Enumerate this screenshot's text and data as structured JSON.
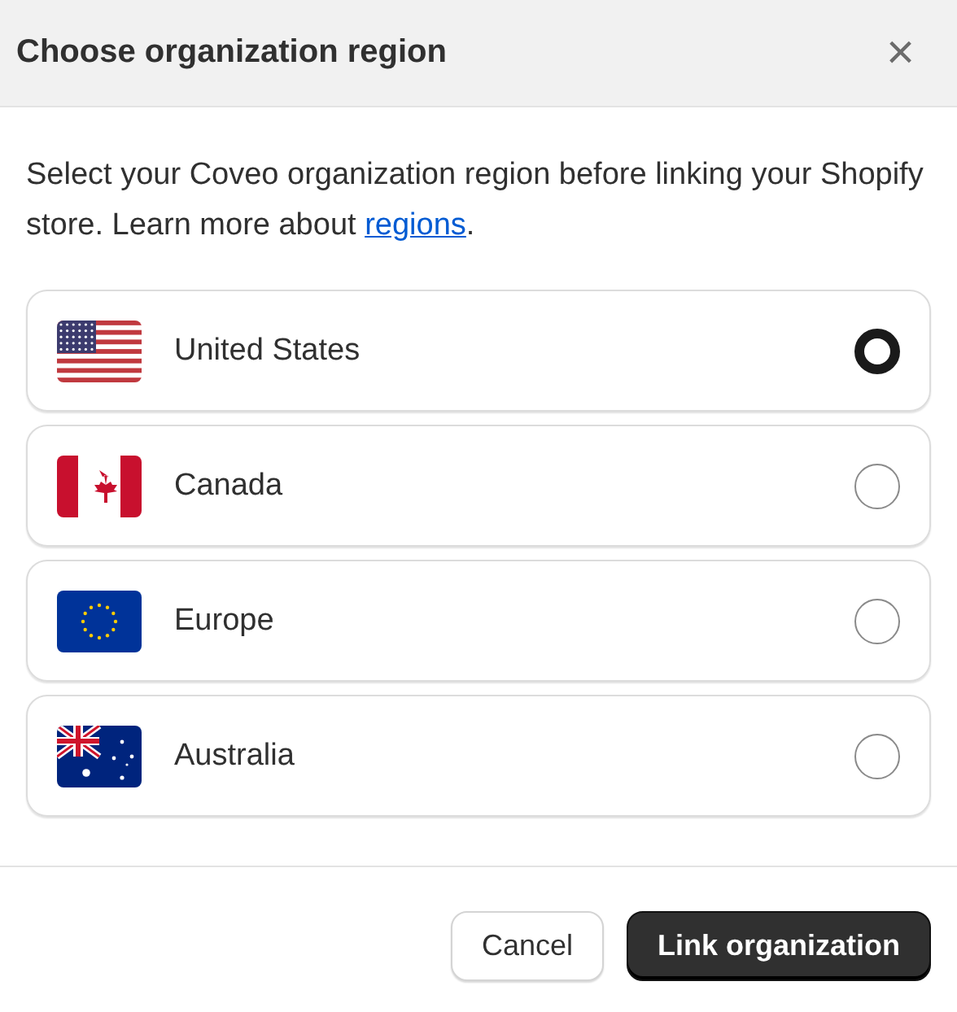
{
  "dialog": {
    "title": "Choose organization region",
    "close": "×"
  },
  "intro": {
    "text": "Select your Coveo organization region before linking your Shopify store. Learn more about ",
    "link": "regions",
    "end": "."
  },
  "regions": [
    {
      "label": "United States",
      "kind": "us",
      "selected": true
    },
    {
      "label": "Canada",
      "kind": "ca",
      "selected": false
    },
    {
      "label": "Europe",
      "kind": "eu",
      "selected": false
    },
    {
      "label": "Australia",
      "kind": "au",
      "selected": false
    }
  ],
  "buttons": [
    {
      "label": "Cancel",
      "kind": "secondary"
    },
    {
      "label": "Link organization",
      "kind": "primary"
    }
  ]
}
